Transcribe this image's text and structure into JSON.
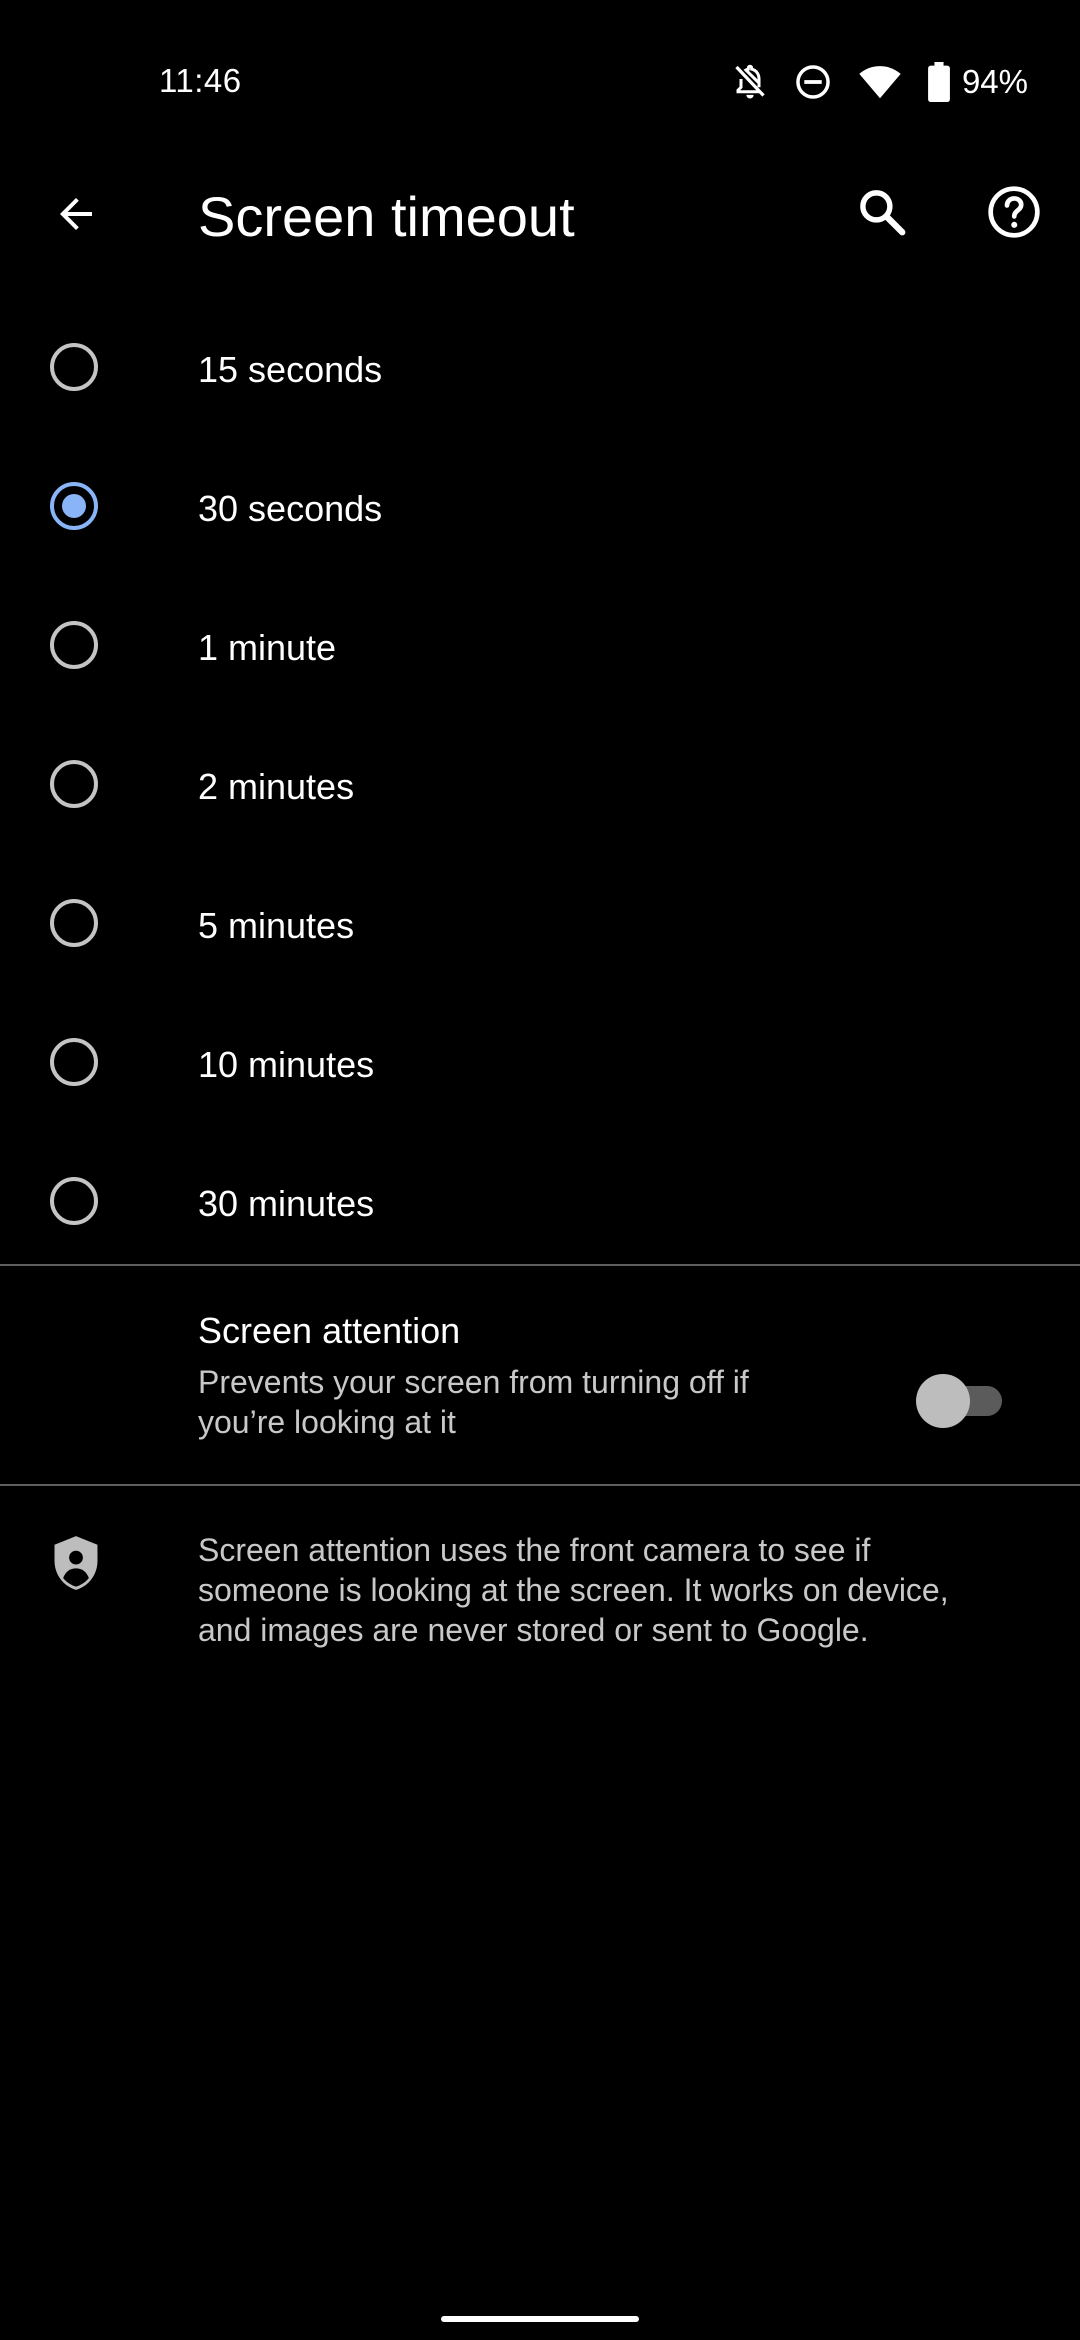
{
  "status_bar": {
    "time": "11:46",
    "battery_percent": "94%",
    "icons": [
      "notifications-off-icon",
      "do-not-disturb-icon",
      "wifi-icon",
      "battery-icon"
    ]
  },
  "toolbar": {
    "title": "Screen timeout",
    "back_icon": "back-arrow-icon",
    "search_icon": "search-icon",
    "help_icon": "help-icon"
  },
  "timeout_options": [
    {
      "label": "15 seconds",
      "selected": false
    },
    {
      "label": "30 seconds",
      "selected": true
    },
    {
      "label": "1 minute",
      "selected": false
    },
    {
      "label": "2 minutes",
      "selected": false
    },
    {
      "label": "5 minutes",
      "selected": false
    },
    {
      "label": "10 minutes",
      "selected": false
    },
    {
      "label": "30 minutes",
      "selected": false
    }
  ],
  "screen_attention": {
    "title": "Screen attention",
    "summary": "Prevents your screen from turning off if you’re looking at it",
    "enabled": false
  },
  "footer": {
    "icon": "privacy-shield-icon",
    "text": "Screen attention uses the front camera to see if someone is looking at the screen. It works on device, and images are never stored or sent to Google."
  },
  "colors": {
    "background": "#000000",
    "accent": "#8ab4f8",
    "radio_unchecked": "#c4c4c4",
    "secondary_text": "#c8c8c8",
    "divider": "#5f5f5f"
  }
}
